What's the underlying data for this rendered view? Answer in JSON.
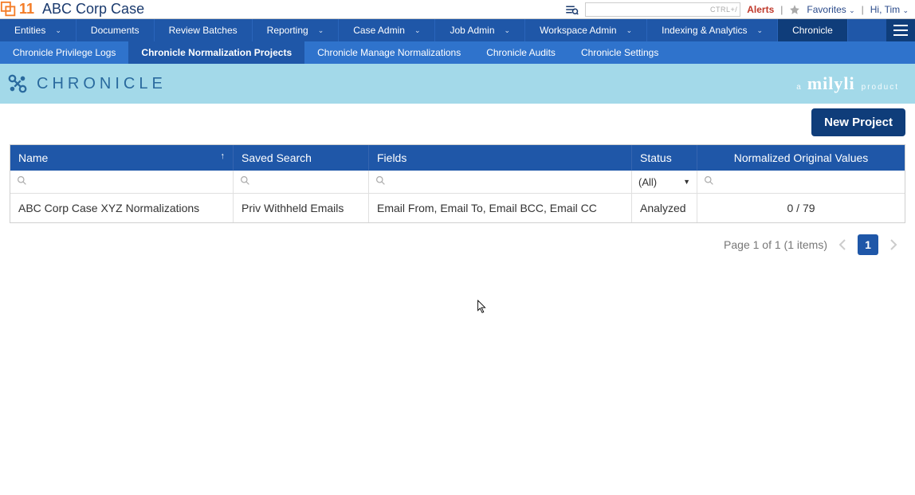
{
  "header": {
    "logo_number": "11",
    "case_title": "ABC Corp Case",
    "search_placeholder": "",
    "shortcut_hint": "CTRL+/",
    "alerts_label": "Alerts",
    "favorites_label": "Favorites",
    "greeting_prefix": "Hi, ",
    "user_name": "Tim"
  },
  "main_nav": {
    "items": [
      {
        "label": "Entities",
        "caret": true
      },
      {
        "label": "Documents",
        "caret": false
      },
      {
        "label": "Review Batches",
        "caret": false
      },
      {
        "label": "Reporting",
        "caret": true
      },
      {
        "label": "Case Admin",
        "caret": true
      },
      {
        "label": "Job Admin",
        "caret": true
      },
      {
        "label": "Workspace Admin",
        "caret": true
      },
      {
        "label": "Indexing & Analytics",
        "caret": true
      },
      {
        "label": "Chronicle",
        "caret": false,
        "active": true
      }
    ]
  },
  "sub_nav": {
    "items": [
      {
        "label": "Chronicle Privilege Logs"
      },
      {
        "label": "Chronicle Normalization Projects",
        "active": true
      },
      {
        "label": "Chronicle Manage Normalizations"
      },
      {
        "label": "Chronicle Audits"
      },
      {
        "label": "Chronicle Settings"
      }
    ]
  },
  "banner": {
    "chronicle_word": "CHRONICLE",
    "milyli_a": "a",
    "milyli_word": "milyli",
    "milyli_product": "product"
  },
  "toolbar": {
    "new_project_label": "New Project"
  },
  "table": {
    "columns": {
      "name": "Name",
      "saved_search": "Saved Search",
      "fields": "Fields",
      "status": "Status",
      "normalized": "Normalized Original Values"
    },
    "status_filter": "(All)",
    "rows": [
      {
        "name": "ABC Corp Case XYZ Normalizations",
        "saved_search": "Priv Withheld Emails",
        "fields": "Email From, Email To, Email BCC, Email CC",
        "status": "Analyzed",
        "normalized": "0 / 79"
      }
    ]
  },
  "pager": {
    "summary": "Page 1 of 1 (1 items)",
    "current_page": "1"
  }
}
